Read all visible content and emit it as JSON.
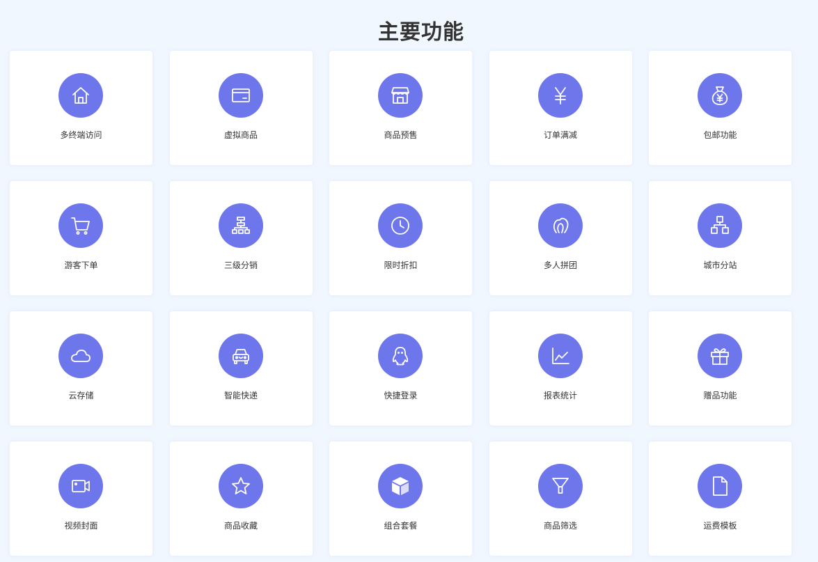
{
  "page": {
    "title": "主要功能"
  },
  "theme": {
    "accent": "#6e76ec",
    "background": "#f1f7fe",
    "card": "#ffffff",
    "text": "#333333"
  },
  "features": [
    {
      "label": "多终端访问",
      "icon": "home-icon"
    },
    {
      "label": "虚拟商品",
      "icon": "card-icon"
    },
    {
      "label": "商品预售",
      "icon": "shop-icon"
    },
    {
      "label": "订单满减",
      "icon": "yen-icon"
    },
    {
      "label": "包邮功能",
      "icon": "money-bag-icon"
    },
    {
      "label": "游客下单",
      "icon": "cart-icon"
    },
    {
      "label": "三级分销",
      "icon": "hierarchy-icon"
    },
    {
      "label": "限时折扣",
      "icon": "clock-icon"
    },
    {
      "label": "多人拼团",
      "icon": "group-icon"
    },
    {
      "label": "城市分站",
      "icon": "network-icon"
    },
    {
      "label": "云存储",
      "icon": "cloud-icon"
    },
    {
      "label": "智能快递",
      "icon": "car-icon"
    },
    {
      "label": "快捷登录",
      "icon": "qq-icon"
    },
    {
      "label": "报表统计",
      "icon": "line-chart-icon"
    },
    {
      "label": "赠品功能",
      "icon": "gift-icon"
    },
    {
      "label": "视频封面",
      "icon": "video-icon"
    },
    {
      "label": "商品收藏",
      "icon": "star-icon"
    },
    {
      "label": "组合套餐",
      "icon": "box-icon"
    },
    {
      "label": "商品筛选",
      "icon": "filter-icon"
    },
    {
      "label": "运费模板",
      "icon": "document-icon"
    }
  ]
}
